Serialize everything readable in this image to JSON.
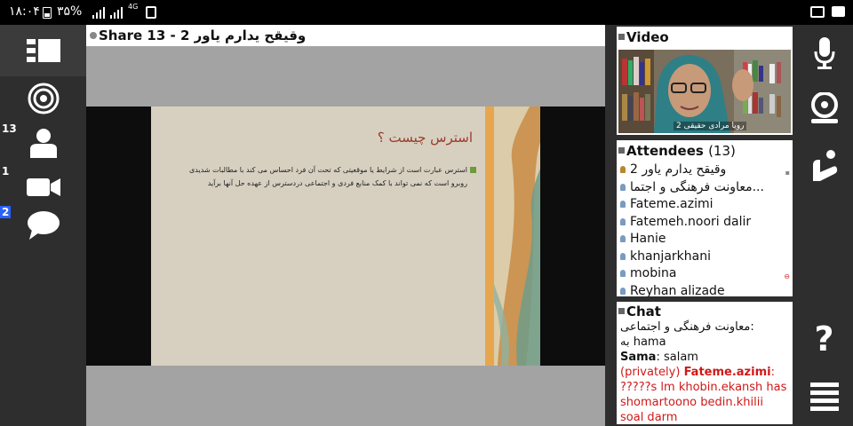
{
  "status_bar": {
    "time": "۱۸:۰۴",
    "battery": "۳۵%",
    "network": "4G",
    "icons": [
      "battery-icon",
      "signal-icon",
      "sd-card-icon",
      "gallery-icon",
      "message-icon"
    ]
  },
  "left_toolbar": {
    "items": [
      {
        "name": "layout-icon"
      },
      {
        "name": "broadcast-icon"
      },
      {
        "name": "attendees-icon",
        "badge": "13"
      },
      {
        "name": "camera-icon",
        "badge": "1"
      },
      {
        "name": "chat-icon",
        "badge": "2"
      }
    ]
  },
  "share": {
    "title": "Share 13 - 2 وقیقح یدارم یاور",
    "slide_title": "استرس چیست ؟",
    "slide_text": "استرس عبارت است از شرایط یا موقعیتی که تحت آن فرد احساس می کند با مطالبات شدیدی روبرو است که نمی تواند با کمک منابع فردی و اجتماعی دردسترس از عهده حل آنها برآید"
  },
  "video": {
    "title": "Video",
    "caption": "رویا مرادی حقیقی 2"
  },
  "attendees": {
    "title": "Attendees",
    "count": "(13)",
    "list": [
      {
        "name": "2 وقیقح یدارم یاور",
        "host": true
      },
      {
        "name": "معاونت فرهنگی و اجتما...",
        "host": false
      },
      {
        "name": "Fateme.azimi",
        "host": false
      },
      {
        "name": "Fatemeh.noori dalir",
        "host": false
      },
      {
        "name": "Hanie",
        "host": false
      },
      {
        "name": "khanjarkhani",
        "host": false
      },
      {
        "name": "mobina",
        "host": false
      },
      {
        "name": "Reyhan alizade",
        "host": false
      }
    ]
  },
  "chat": {
    "title": "Chat",
    "messages": [
      {
        "sender": "معاونت فرهنگی و اجتماعی:",
        "text": "به hama"
      },
      {
        "sender": "Sama",
        "text": ": salam"
      },
      {
        "prefix": "(privately)",
        "sender": "Fateme.azimi",
        "text": ": ?????s lm khobin.ekansh has shomartoono bedin.khilii soal darm"
      }
    ]
  },
  "right_toolbar": {
    "items": [
      "microphone-icon",
      "webcam-icon",
      "raise-hand-icon",
      "help-icon",
      "menu-icon"
    ],
    "help_label": "?"
  },
  "colors": {
    "accent_blue": "#2962ff",
    "chat_private": "#d01818",
    "slide_title": "#9b3b2a"
  }
}
